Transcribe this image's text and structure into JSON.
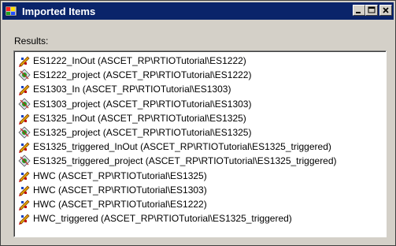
{
  "window": {
    "title": "Imported Items"
  },
  "results_label": "Results:",
  "items": [
    {
      "label": "ES1222_InOut (ASCET_RP\\RTIOTutorial\\ES1222)",
      "icon": "module-icon"
    },
    {
      "label": "ES1222_project (ASCET_RP\\RTIOTutorial\\ES1222)",
      "icon": "project-icon"
    },
    {
      "label": "ES1303_In (ASCET_RP\\RTIOTutorial\\ES1303)",
      "icon": "module-icon"
    },
    {
      "label": "ES1303_project (ASCET_RP\\RTIOTutorial\\ES1303)",
      "icon": "project-icon"
    },
    {
      "label": "ES1325_InOut (ASCET_RP\\RTIOTutorial\\ES1325)",
      "icon": "module-icon"
    },
    {
      "label": "ES1325_project (ASCET_RP\\RTIOTutorial\\ES1325)",
      "icon": "project-icon"
    },
    {
      "label": "ES1325_triggered_InOut (ASCET_RP\\RTIOTutorial\\ES1325_triggered)",
      "icon": "module-icon"
    },
    {
      "label": "ES1325_triggered_project (ASCET_RP\\RTIOTutorial\\ES1325_triggered)",
      "icon": "project-icon"
    },
    {
      "label": "HWC (ASCET_RP\\RTIOTutorial\\ES1325)",
      "icon": "module-icon"
    },
    {
      "label": "HWC (ASCET_RP\\RTIOTutorial\\ES1303)",
      "icon": "module-icon"
    },
    {
      "label": "HWC (ASCET_RP\\RTIOTutorial\\ES1222)",
      "icon": "module-icon"
    },
    {
      "label": "HWC_triggered (ASCET_RP\\RTIOTutorial\\ES1325_triggered)",
      "icon": "module-icon"
    }
  ]
}
